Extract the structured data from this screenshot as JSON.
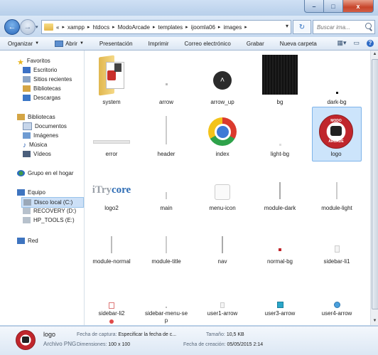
{
  "window": {
    "minimize_label": "–",
    "maximize_label": "□",
    "close_label": "x"
  },
  "address": {
    "overflow": "«",
    "crumbs": [
      "xampp",
      "htdocs",
      "ModoArcade",
      "templates",
      "ijoomla06",
      "images"
    ],
    "search_placeholder": "Buscar ima...",
    "search_label": "Buscar ima..."
  },
  "toolbar": {
    "items": [
      "Organizar",
      "Abrir",
      "Presentación",
      "Imprimir",
      "Correo electrónico",
      "Grabar",
      "Nueva carpeta"
    ],
    "organizar": "Organizar",
    "abrir": "Abrir",
    "presentacion": "Presentación",
    "imprimir": "Imprimir",
    "correo": "Correo electrónico",
    "grabar": "Grabar",
    "nueva_carpeta": "Nueva carpeta"
  },
  "nav": {
    "favoritos": "Favoritos",
    "escritorio": "Escritorio",
    "sitios": "Sitios recientes",
    "bibliotecas_fav": "Bibliotecas",
    "descargas": "Descargas",
    "bibliotecas": "Bibliotecas",
    "documentos": "Documentos",
    "imagenes": "Imágenes",
    "musica": "Música",
    "videos": "Vídeos",
    "grupo": "Grupo en el hogar",
    "equipo": "Equipo",
    "disco_c": "Disco local (C:)",
    "recovery": "RECOVERY (D:)",
    "hp_tools": "HP_TOOLS (E:)",
    "red": "Red"
  },
  "files": {
    "system": "system",
    "arrow": "arrow",
    "arrow_up": "arrow_up",
    "bg": "bg",
    "dark_bg": "dark-bg",
    "error": "error",
    "header": "header",
    "index": "index",
    "light_bg": "light-bg",
    "logo": "logo",
    "logo2": "logo2",
    "main": "main",
    "menu_icon": "menu-icon",
    "module_dark": "module-dark",
    "module_light": "module-light",
    "module_normal": "module-normal",
    "module_title": "module-title",
    "nav": "nav",
    "normal_bg": "normal-bg",
    "sidebar_li1": "sidebar-li1",
    "sidebar_li2": "sidebar-li2",
    "sidebar_menu_sep_line1": "sidebar-menu-se",
    "sidebar_menu_sep_line2": "p",
    "user1_arrow": "user1-arrow",
    "user3_arrow": "user3-arrow",
    "user4_arrow": "user4-arrow"
  },
  "logo_thumb": {
    "line1": "MODO",
    "line2": "ARCADE"
  },
  "logo2_thumb": {
    "part1": "iTry",
    "part2": "core"
  },
  "details": {
    "name": "logo",
    "type": "Archivo PNG",
    "fecha_captura_label": "Fecha de captura:",
    "fecha_captura_value": "Especificar la fecha de c...",
    "dimensiones_label": "Dimensiones:",
    "dimensiones_value": "100 x 100",
    "tamano_label": "Tamaño:",
    "tamano_value": "10,5 KB",
    "fecha_creacion_label": "Fecha de creación:",
    "fecha_creacion_value": "05/05/2015 2:14"
  },
  "colors": {
    "accent": "#2e6bc6",
    "selection": "#cce4fb",
    "logo_red": "#c0262c"
  }
}
